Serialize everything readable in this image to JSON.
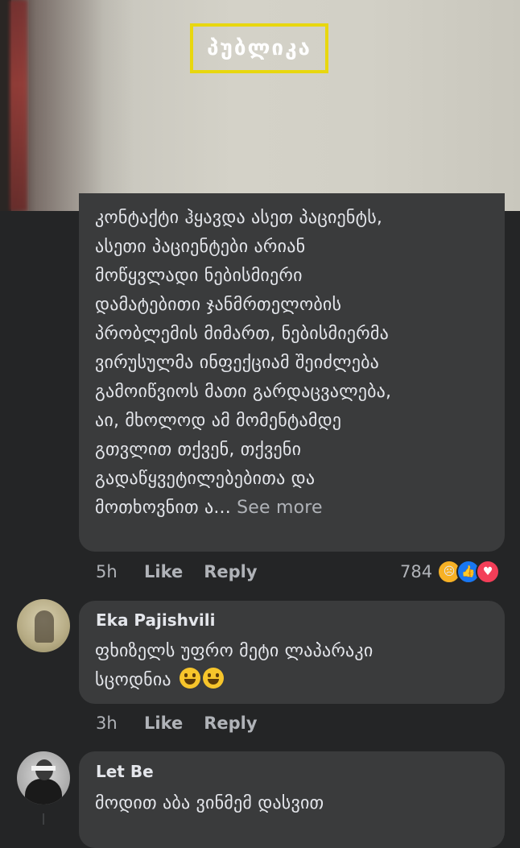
{
  "video": {
    "brand_text": "პუბლიკა",
    "colors": {
      "frame": "#e8d70f"
    }
  },
  "comments": [
    {
      "body": "კონტაქტი ჰყავდა ასეთ პაციენტს,\nასეთი პაციენტები არიან\nმოწყვლადი ნებისმიერი\nდამატებითი ჯანმრთელობის\nპრობლემის მიმართ, ნებისმიერმა\nვირუსულმა ინფექციამ შეიძლება\nგამოიწვიოს მათი გარდაცვალება,\nაი, მხოლოდ ამ მომენტამდე\nგთვლით თქვენ, თქვენი\nგადაწყვეტილებებითა და\nმოთხოვნით ა...",
      "see_more": "See more",
      "time": "5h",
      "like": "Like",
      "reply": "Reply",
      "reaction_count": "784",
      "reactions": [
        "sad-icon",
        "like-icon",
        "love-icon"
      ]
    },
    {
      "author": "Eka Pajishvili",
      "body": "ფხიზელს უფრო მეტი ლაპარაკი\nსცოდნია",
      "emojis": [
        "grinning-emoji",
        "grinning-emoji"
      ],
      "time": "3h",
      "like": "Like",
      "reply": "Reply"
    },
    {
      "author": "Let Be",
      "body": "მოდით აბა ვინმემ დასვით"
    }
  ]
}
